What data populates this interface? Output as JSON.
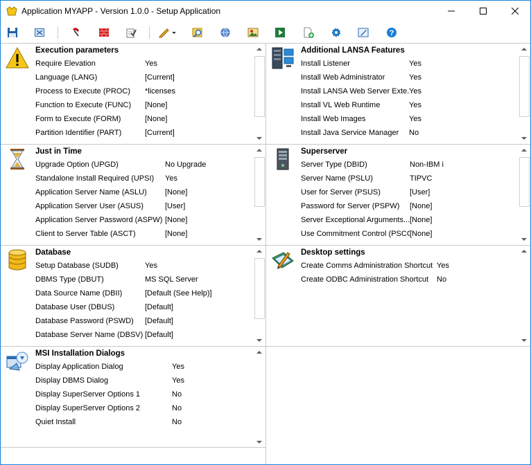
{
  "window": {
    "title": "Application MYAPP - Version 1.0.0 - Setup Application",
    "controls": {
      "minimize": "minimize",
      "maximize": "maximize",
      "close": "close"
    }
  },
  "toolbar": {
    "buttons": [
      "save-icon",
      "close-file-icon",
      "magnet-icon",
      "firewall-icon",
      "checklist-icon",
      "pencil-dropdown-icon",
      "find-icon",
      "settings-globe-icon",
      "image-icon",
      "media-play-icon",
      "add-document-icon",
      "gear-icon",
      "edit-image-icon",
      "help-icon"
    ]
  },
  "panels": {
    "execution": {
      "title": "Execution parameters",
      "rows": [
        {
          "label": "Require Elevation",
          "value": "Yes"
        },
        {
          "label": "Language (LANG)",
          "value": "[Current]"
        },
        {
          "label": "Process to Execute (PROC)",
          "value": "*licenses"
        },
        {
          "label": "Function to Execute (FUNC)",
          "value": "[None]"
        },
        {
          "label": "Form to Execute (FORM)",
          "value": "[None]"
        },
        {
          "label": "Partition Identifier (PART)",
          "value": "[Current]"
        }
      ]
    },
    "lansa": {
      "title": "Additional LANSA Features",
      "rows": [
        {
          "label": "Install Listener",
          "value": "Yes"
        },
        {
          "label": "Install Web Administrator",
          "value": "Yes"
        },
        {
          "label": "Install LANSA Web Server Exte...",
          "value": "Yes"
        },
        {
          "label": "Install VL Web Runtime",
          "value": "Yes"
        },
        {
          "label": "Install Web Images",
          "value": "Yes"
        },
        {
          "label": "Install Java Service Manager",
          "value": "No"
        }
      ]
    },
    "jit": {
      "title": "Just in Time",
      "rows": [
        {
          "label": "Upgrade Option (UPGD)",
          "value": "No Upgrade"
        },
        {
          "label": "Standalone Install Required (UPSI)",
          "value": "Yes"
        },
        {
          "label": "Application Server Name (ASLU)",
          "value": "[None]"
        },
        {
          "label": "Application Server User (ASUS)",
          "value": "[User]"
        },
        {
          "label": "Application Server Password (ASPW)",
          "value": "[None]"
        },
        {
          "label": "Client to Server Table (ASCT)",
          "value": "[None]"
        }
      ]
    },
    "superserver": {
      "title": "Superserver",
      "rows": [
        {
          "label": "Server Type (DBID)",
          "value": "Non-IBM i"
        },
        {
          "label": "Server Name (PSLU)",
          "value": "TIPVC"
        },
        {
          "label": "User for Server (PSUS)",
          "value": "[User]"
        },
        {
          "label": "Password for Server (PSPW)",
          "value": "[None]"
        },
        {
          "label": "Server Exceptional Arguments...",
          "value": "[None]"
        },
        {
          "label": "Use Commitment Control (PSCC)",
          "value": "[None]"
        }
      ]
    },
    "database": {
      "title": "Database",
      "rows": [
        {
          "label": "Setup Database (SUDB)",
          "value": "Yes"
        },
        {
          "label": "DBMS Type (DBUT)",
          "value": "MS SQL Server"
        },
        {
          "label": "Data Source Name (DBII)",
          "value": "[Default (See Help)]"
        },
        {
          "label": "Database User (DBUS)",
          "value": "[Default]"
        },
        {
          "label": "Database Password (PSWD)",
          "value": "[Default]"
        },
        {
          "label": "Database Server Name (DBSV)",
          "value": "[Default]"
        }
      ]
    },
    "desktop": {
      "title": "Desktop settings",
      "rows": [
        {
          "label": "Create Comms Administration Shortcut",
          "value": "Yes"
        },
        {
          "label": "Create ODBC Administration Shortcut",
          "value": "No"
        }
      ]
    },
    "msi": {
      "title": "MSI Installation Dialogs",
      "rows": [
        {
          "label": "Display Application Dialog",
          "value": "Yes"
        },
        {
          "label": "Display DBMS Dialog",
          "value": "Yes"
        },
        {
          "label": "Display SuperServer Options 1",
          "value": "No"
        },
        {
          "label": "Display SuperServer Options 2",
          "value": "No"
        },
        {
          "label": "Quiet Install",
          "value": "No"
        }
      ]
    }
  }
}
